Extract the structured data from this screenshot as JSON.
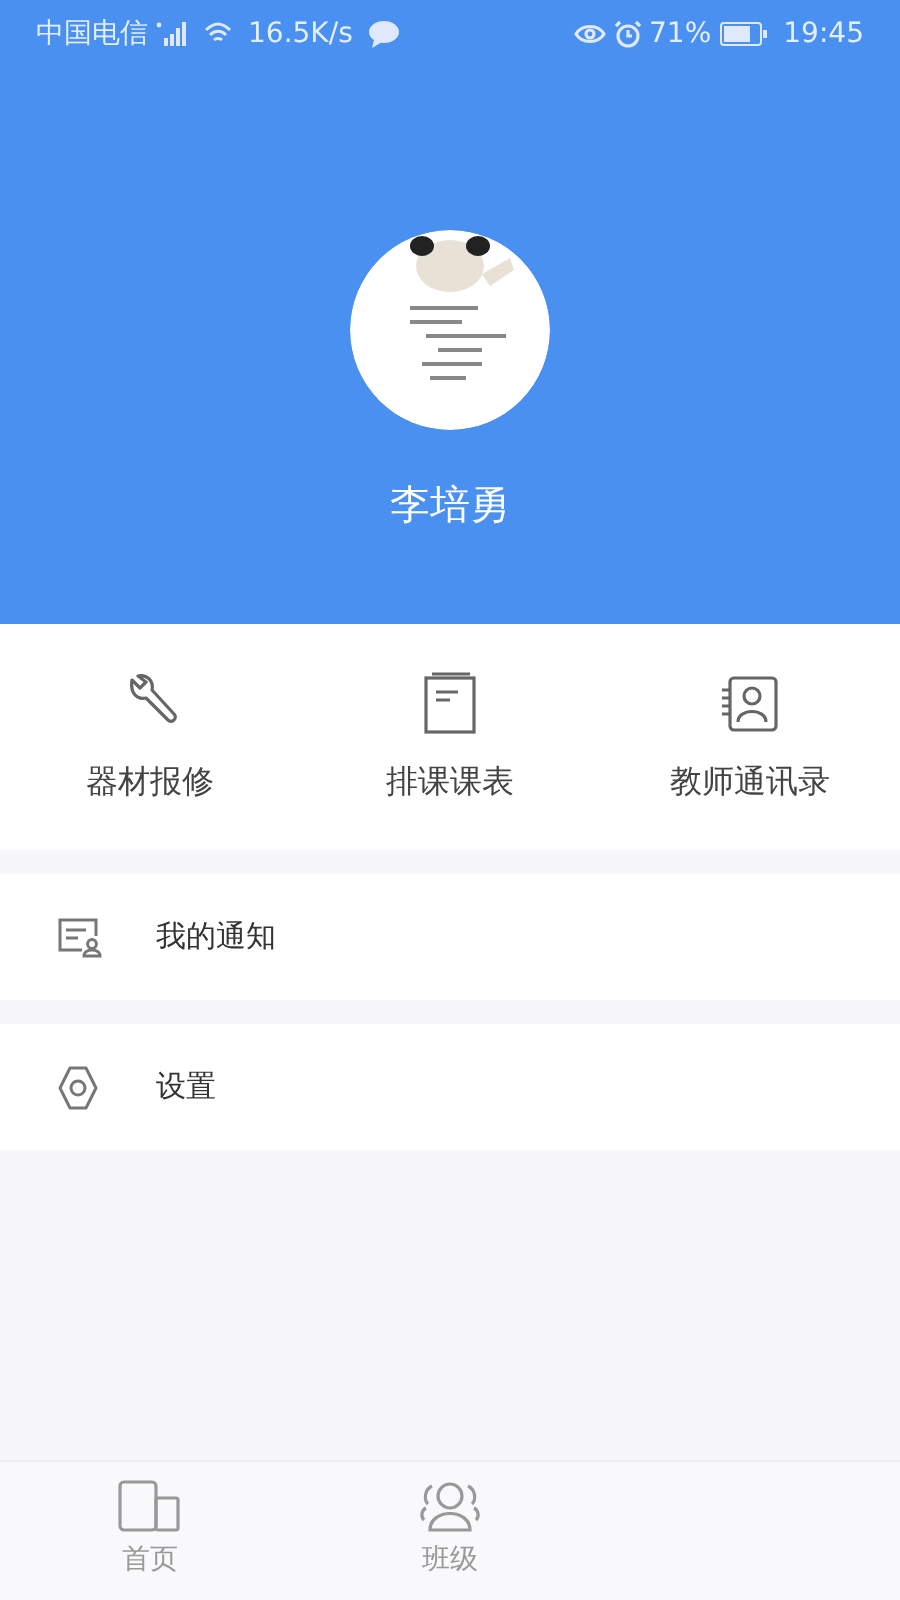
{
  "status_bar": {
    "carrier": "中国电信",
    "speed": "16.5K/s",
    "battery": "71%",
    "time": "19:45"
  },
  "profile": {
    "name": "李培勇"
  },
  "shortcuts": [
    {
      "label": "器材报修",
      "kind": "wrench"
    },
    {
      "label": "排课课表",
      "kind": "book"
    },
    {
      "label": "教师通讯录",
      "kind": "contacts"
    }
  ],
  "menu": [
    {
      "label": "我的通知",
      "kind": "notice"
    },
    {
      "label": "设置",
      "kind": "settings"
    }
  ],
  "tab_bar": [
    {
      "label": "首页",
      "kind": "home",
      "selected": false
    },
    {
      "label": "班级",
      "kind": "class",
      "selected": false
    }
  ]
}
